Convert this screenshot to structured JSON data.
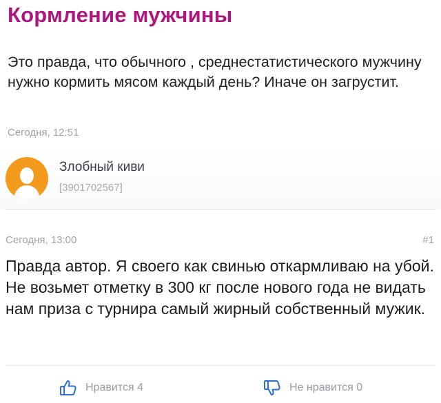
{
  "topic": {
    "title": "Кормление мужчины",
    "question": "Это правда, что обычного , среднестатистического мужчину нужно кормить мясом каждый день? Иначе он загрустит.",
    "time": "Сегодня, 12:51"
  },
  "author": {
    "name": "Злобный киви",
    "id": "[3901702567]",
    "avatar_color": "#f39a1c"
  },
  "answer": {
    "time": "Сегодня, 13:00",
    "number": "#1",
    "text": "Правда автор. Я своего как свинью откармливаю на убой. Не возьмет отметку в 300 кг после нового года не видать нам приза с турнира самый жирный собственный мужик."
  },
  "votes": {
    "like_label": "Нравится 4",
    "dislike_label": "Не нравится 0",
    "like_icon": "thumbs-up-icon",
    "dislike_icon": "thumbs-down-icon"
  },
  "colors": {
    "title": "#b0157f",
    "meta": "#a3a3a3",
    "vote": "#9a9aa6"
  }
}
